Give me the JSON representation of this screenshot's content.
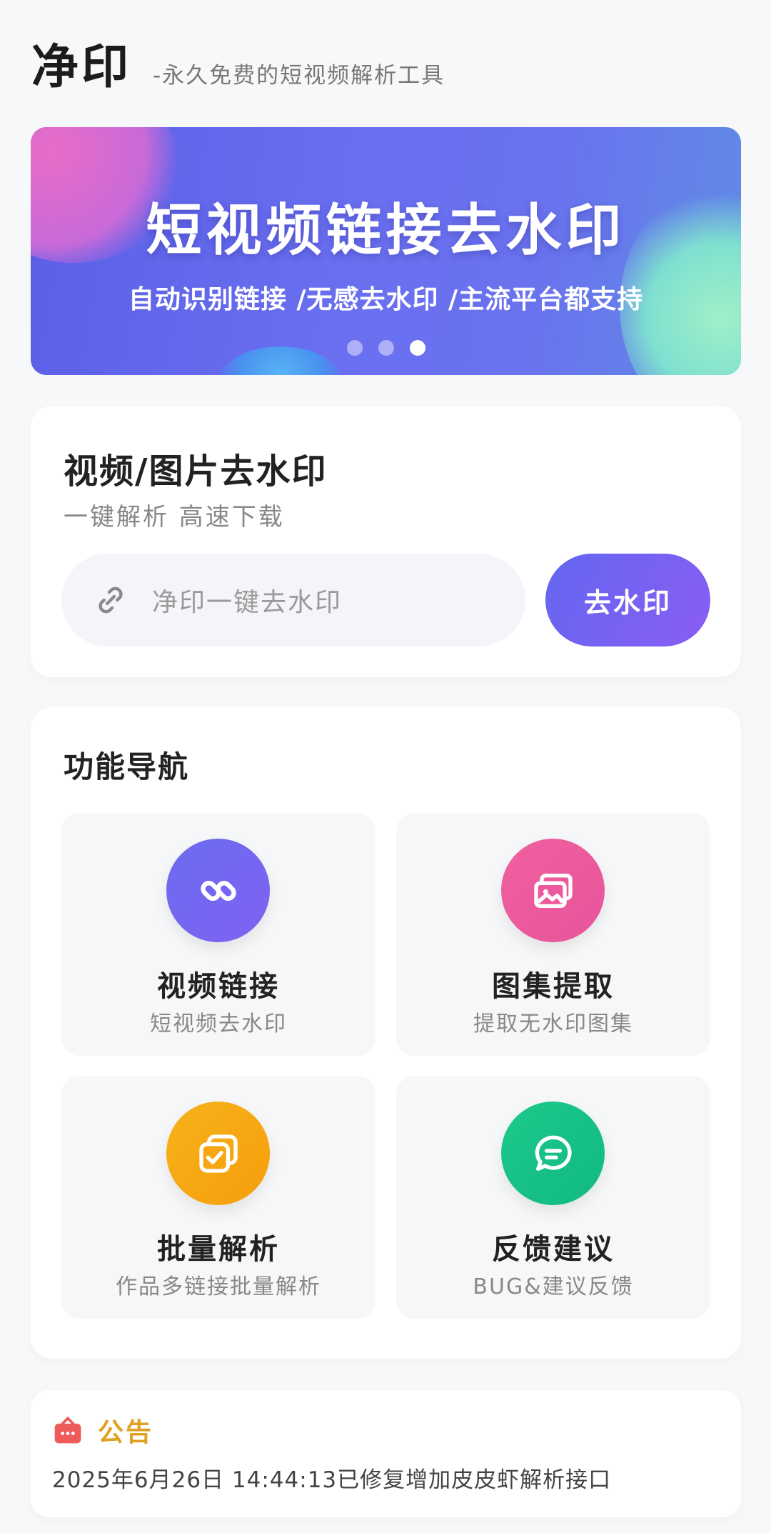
{
  "header": {
    "title": "净印",
    "subtitle": "-永久免费的短视频解析工具"
  },
  "banner": {
    "title": "短视频链接去水印",
    "tagline": "自动识别链接 /无感去水印 /主流平台都支持",
    "slides_total": 3,
    "active_slide": 3
  },
  "parse": {
    "title": "视频/图片去水印",
    "subtitle": "一键解析 高速下载",
    "input_placeholder": "净印一键去水印",
    "input_icon": "link-icon",
    "button_label": "去水印",
    "button_color": "#6366f1"
  },
  "nav": {
    "title": "功能导航",
    "items": [
      {
        "label": "视频链接",
        "desc": "短视频去水印",
        "icon": "link-chain-icon",
        "color": "#6b6cf0"
      },
      {
        "label": "图集提取",
        "desc": "提取无水印图集",
        "icon": "image-gallery-icon",
        "color": "#f0609f"
      },
      {
        "label": "批量解析",
        "desc": "作品多链接批量解析",
        "icon": "batch-check-icon",
        "color": "#f59e0b"
      },
      {
        "label": "反馈建议",
        "desc": "BUG&建议反馈",
        "icon": "chat-bubble-icon",
        "color": "#10b981"
      }
    ]
  },
  "notice": {
    "title": "公告",
    "icon": "megaphone-icon",
    "title_color": "#e0a020",
    "text": "2025年6月26日 14:44:13已修复增加皮皮虾解析接口"
  }
}
